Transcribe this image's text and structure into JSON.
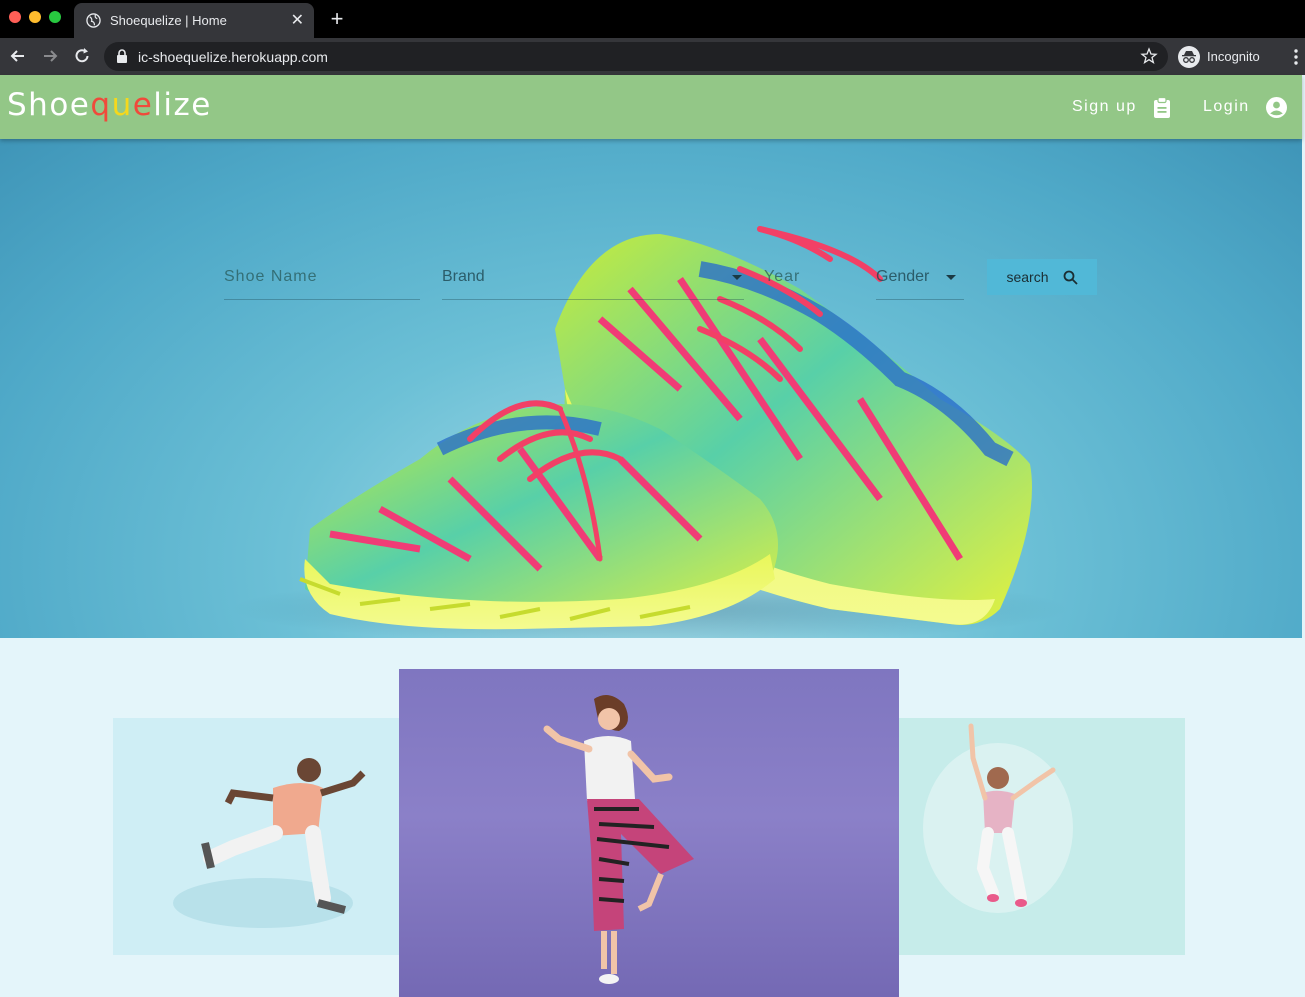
{
  "browser": {
    "tab_title": "Shoequelize | Home",
    "url": "ic-shoequelize.herokuapp.com",
    "incognito_label": "Incognito"
  },
  "header": {
    "logo_parts": [
      "Shoe",
      "q",
      "u",
      "e",
      "lize"
    ],
    "signup_label": "Sign up",
    "login_label": "Login",
    "background_color": "#93c787"
  },
  "search": {
    "shoe_name_placeholder": "Shoe Name",
    "brand_label": "Brand",
    "year_placeholder": "Year",
    "gender_label": "Gender",
    "button_label": "search"
  },
  "hero": {
    "image": "colorful-running-shoes-on-blue-background"
  },
  "gallery": {
    "items": [
      {
        "image": "man-running-jump"
      },
      {
        "image": "woman-dancing-purple-background"
      },
      {
        "image": "girl-jumping"
      }
    ]
  }
}
